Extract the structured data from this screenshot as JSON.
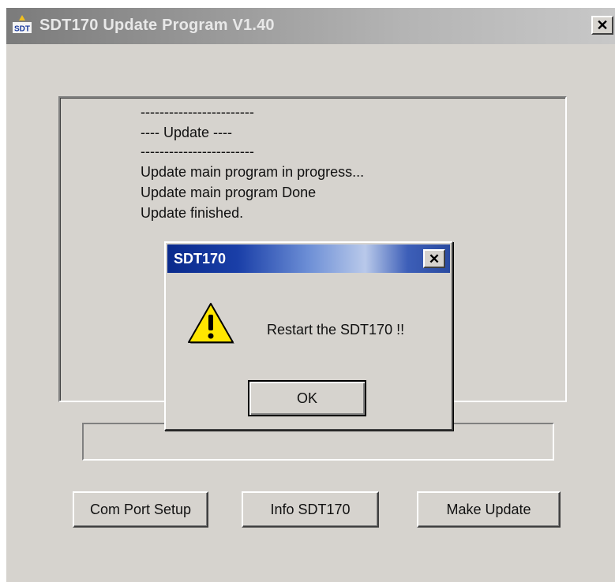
{
  "window": {
    "title": "SDT170 Update Program V1.40",
    "app_icon_label": "SDT",
    "close_glyph": "✕"
  },
  "log": {
    "lines": [
      "------------------------",
      "----  Update ----",
      "------------------------",
      "Update main program in progress...",
      "Update main program Done",
      "Update finished."
    ]
  },
  "progress": {
    "value": 0
  },
  "buttons": {
    "com_port_setup": "Com Port Setup",
    "info": "Info SDT170",
    "make_update": "Make Update"
  },
  "dialog": {
    "title": "SDT170",
    "close_glyph": "✕",
    "icon": "warning-icon",
    "message": "Restart the SDT170 !!",
    "ok_label": "OK"
  },
  "colors": {
    "window_bg": "#d6d3ce",
    "dialog_title_gradient_start": "#0a2a8c",
    "dialog_title_gradient_mid": "#b9c9ea",
    "warning_yellow": "#ffe600"
  }
}
